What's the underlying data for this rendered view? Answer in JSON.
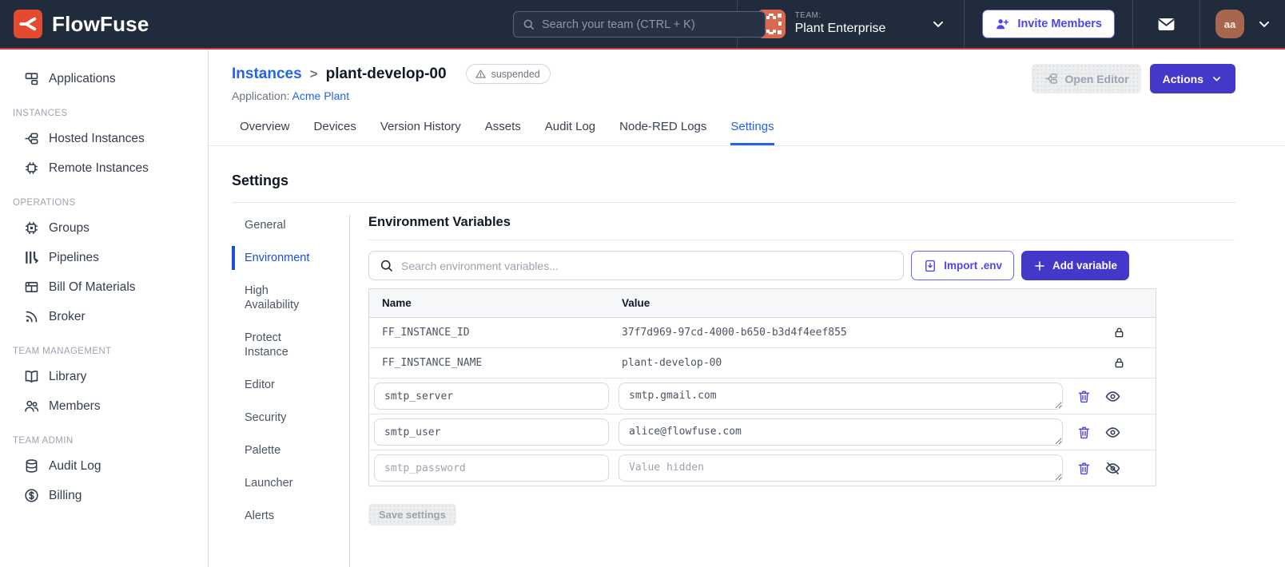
{
  "navbar": {
    "brand": "FlowFuse",
    "search_placeholder": "Search your team (CTRL + K)",
    "team_label": "TEAM:",
    "team_name": "Plant Enterprise",
    "invite_button": "Invite Members",
    "avatar_initials": "aa"
  },
  "sidebar": {
    "sections": [
      {
        "label": "",
        "items": [
          {
            "label": "Applications"
          }
        ]
      },
      {
        "label": "INSTANCES",
        "items": [
          {
            "label": "Hosted Instances"
          },
          {
            "label": "Remote Instances"
          }
        ]
      },
      {
        "label": "OPERATIONS",
        "items": [
          {
            "label": "Groups"
          },
          {
            "label": "Pipelines"
          },
          {
            "label": "Bill Of Materials"
          },
          {
            "label": "Broker"
          }
        ]
      },
      {
        "label": "TEAM MANAGEMENT",
        "items": [
          {
            "label": "Library"
          },
          {
            "label": "Members"
          }
        ]
      },
      {
        "label": "TEAM ADMIN",
        "items": [
          {
            "label": "Audit Log"
          },
          {
            "label": "Billing"
          }
        ]
      }
    ]
  },
  "header": {
    "breadcrumb_parent": "Instances",
    "breadcrumb_separator": ">",
    "instance_name": "plant-develop-00",
    "status_badge": "suspended",
    "application_label": "Application:",
    "application_name": "Acme Plant",
    "open_editor_button": "Open Editor",
    "actions_button": "Actions"
  },
  "tabs": {
    "items": [
      "Overview",
      "Devices",
      "Version History",
      "Assets",
      "Audit Log",
      "Node-RED Logs",
      "Settings"
    ],
    "active": "Settings"
  },
  "settings": {
    "title": "Settings",
    "nav": [
      "General",
      "Environment",
      "High Availability",
      "Protect Instance",
      "Editor",
      "Security",
      "Palette",
      "Launcher",
      "Alerts"
    ],
    "active_nav": "Environment",
    "env": {
      "heading": "Environment Variables",
      "search_placeholder": "Search environment variables...",
      "import_button": "Import .env",
      "add_button": "Add variable",
      "columns": [
        "Name",
        "Value"
      ],
      "locked_rows": [
        {
          "name": "FF_INSTANCE_ID",
          "value": "37f7d969-97cd-4000-b650-b3d4f4eef855"
        },
        {
          "name": "FF_INSTANCE_NAME",
          "value": "plant-develop-00"
        }
      ],
      "editable_rows": [
        {
          "name": "smtp_server",
          "value": "smtp.gmail.com",
          "hidden": false
        },
        {
          "name": "smtp_user",
          "value": "alice@flowfuse.com",
          "hidden": false
        },
        {
          "name": "smtp_password",
          "value": "",
          "value_placeholder": "Value hidden",
          "hidden": true
        }
      ],
      "save_button": "Save settings"
    }
  },
  "colors": {
    "topbar": "#202B3B",
    "brand_red": "#E5492F",
    "accent_red_line": "#D2333E",
    "accent_indigo": "#4338CA",
    "link_blue": "#2563EB"
  }
}
